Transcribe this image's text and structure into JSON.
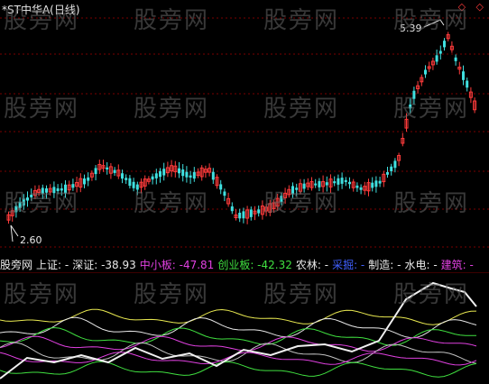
{
  "title": "*ST中华A(日线)",
  "top_icons": "◇ ◇",
  "annotations": {
    "high": "5.39",
    "low": "2.60"
  },
  "indicator": {
    "name": "股旁网",
    "items": [
      {
        "label": "上证:",
        "value": "-",
        "color": "#e8e8e8"
      },
      {
        "label": "深证:",
        "value": "-38.93",
        "color": "#e8e8e8"
      },
      {
        "label": "中小板:",
        "value": "-47.81",
        "color": "#e040e0"
      },
      {
        "label": "创业板:",
        "value": "-42.32",
        "color": "#40e040"
      },
      {
        "label": "农林:",
        "value": "-",
        "color": "#e8e8e8"
      },
      {
        "label": "采掘:",
        "value": "-",
        "color": "#4060ff"
      },
      {
        "label": "制造:",
        "value": "-",
        "color": "#e8e8e8"
      },
      {
        "label": "水电:",
        "value": "-",
        "color": "#e8e8e8"
      },
      {
        "label": "建筑:",
        "value": "-",
        "color": "#e040e0"
      }
    ]
  },
  "watermark": "股旁网",
  "colors": {
    "up": "#ff3b3b",
    "down": "#40e0e0",
    "grid": "#7a0000"
  }
}
